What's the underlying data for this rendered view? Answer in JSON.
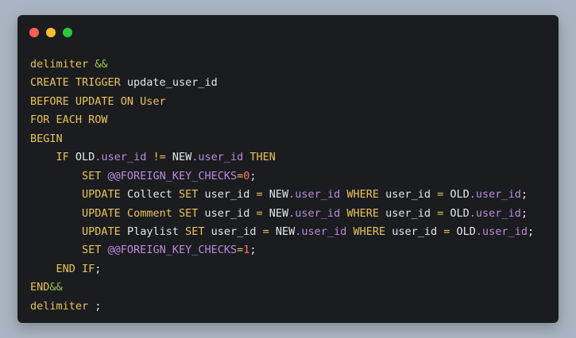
{
  "window": {
    "buttons": [
      {
        "name": "close",
        "color": "#ff5f57"
      },
      {
        "name": "minimize",
        "color": "#febc2e"
      },
      {
        "name": "maximize",
        "color": "#28c840"
      }
    ]
  },
  "colors": {
    "background": "#a9b5c2",
    "editor": "#1b1c1f",
    "keyword": "#e8c35c",
    "plain": "#e6e6e6",
    "property": "#b98bdc",
    "number": "#ff6b6b",
    "delimiter_symbol": "#96c24a"
  },
  "code_lines": [
    [
      {
        "t": "delimiter ",
        "c": "keyword"
      },
      {
        "t": "&&",
        "c": "amp"
      }
    ],
    [
      {
        "t": "CREATE TRIGGER ",
        "c": "keyword"
      },
      {
        "t": "update_user_id",
        "c": "plain"
      }
    ],
    [
      {
        "t": "BEFORE UPDATE ON ",
        "c": "keyword"
      },
      {
        "t": "User",
        "c": "keyword"
      }
    ],
    [
      {
        "t": "FOR EACH ROW",
        "c": "keyword"
      }
    ],
    [
      {
        "t": "BEGIN",
        "c": "keyword"
      }
    ],
    [
      {
        "t": "    ",
        "c": "plain"
      },
      {
        "t": "IF ",
        "c": "keyword"
      },
      {
        "t": "OLD",
        "c": "plain"
      },
      {
        "t": ".user_id",
        "c": "prop"
      },
      {
        "t": " != ",
        "c": "op"
      },
      {
        "t": "NEW",
        "c": "plain"
      },
      {
        "t": ".user_id",
        "c": "prop"
      },
      {
        "t": " THEN",
        "c": "keyword"
      }
    ],
    [
      {
        "t": "        ",
        "c": "plain"
      },
      {
        "t": "SET ",
        "c": "keyword"
      },
      {
        "t": "@@FOREIGN_KEY_CHECKS",
        "c": "var"
      },
      {
        "t": "=",
        "c": "op"
      },
      {
        "t": "0",
        "c": "num"
      },
      {
        "t": ";",
        "c": "plain"
      }
    ],
    [
      {
        "t": "        ",
        "c": "plain"
      },
      {
        "t": "UPDATE ",
        "c": "keyword"
      },
      {
        "t": "Collect ",
        "c": "plain"
      },
      {
        "t": "SET ",
        "c": "keyword"
      },
      {
        "t": "user_id ",
        "c": "plain"
      },
      {
        "t": "= ",
        "c": "op"
      },
      {
        "t": "NEW",
        "c": "plain"
      },
      {
        "t": ".user_id",
        "c": "prop"
      },
      {
        "t": " WHERE ",
        "c": "keyword"
      },
      {
        "t": "user_id ",
        "c": "plain"
      },
      {
        "t": "= ",
        "c": "op"
      },
      {
        "t": "OLD",
        "c": "plain"
      },
      {
        "t": ".user_id",
        "c": "prop"
      },
      {
        "t": ";",
        "c": "plain"
      }
    ],
    [
      {
        "t": "        ",
        "c": "plain"
      },
      {
        "t": "UPDATE ",
        "c": "keyword"
      },
      {
        "t": "Comment ",
        "c": "keyword"
      },
      {
        "t": "SET ",
        "c": "keyword"
      },
      {
        "t": "user_id ",
        "c": "plain"
      },
      {
        "t": "= ",
        "c": "op"
      },
      {
        "t": "NEW",
        "c": "plain"
      },
      {
        "t": ".user_id",
        "c": "prop"
      },
      {
        "t": " WHERE ",
        "c": "keyword"
      },
      {
        "t": "user_id ",
        "c": "plain"
      },
      {
        "t": "= ",
        "c": "op"
      },
      {
        "t": "OLD",
        "c": "plain"
      },
      {
        "t": ".user_id",
        "c": "prop"
      },
      {
        "t": ";",
        "c": "plain"
      }
    ],
    [
      {
        "t": "        ",
        "c": "plain"
      },
      {
        "t": "UPDATE ",
        "c": "keyword"
      },
      {
        "t": "Playlist ",
        "c": "plain"
      },
      {
        "t": "SET ",
        "c": "keyword"
      },
      {
        "t": "user_id ",
        "c": "plain"
      },
      {
        "t": "= ",
        "c": "op"
      },
      {
        "t": "NEW",
        "c": "plain"
      },
      {
        "t": ".user_id",
        "c": "prop"
      },
      {
        "t": " WHERE ",
        "c": "keyword"
      },
      {
        "t": "user_id ",
        "c": "plain"
      },
      {
        "t": "= ",
        "c": "op"
      },
      {
        "t": "OLD",
        "c": "plain"
      },
      {
        "t": ".user_id",
        "c": "prop"
      },
      {
        "t": ";",
        "c": "plain"
      }
    ],
    [
      {
        "t": "        ",
        "c": "plain"
      },
      {
        "t": "SET ",
        "c": "keyword"
      },
      {
        "t": "@@FOREIGN_KEY_CHECKS",
        "c": "var"
      },
      {
        "t": "=",
        "c": "op"
      },
      {
        "t": "1",
        "c": "num"
      },
      {
        "t": ";",
        "c": "plain"
      }
    ],
    [
      {
        "t": "    ",
        "c": "plain"
      },
      {
        "t": "END IF",
        "c": "keyword"
      },
      {
        "t": ";",
        "c": "plain"
      }
    ],
    [
      {
        "t": "END",
        "c": "keyword"
      },
      {
        "t": "&&",
        "c": "amp"
      }
    ],
    [
      {
        "t": "delimiter ",
        "c": "keyword"
      },
      {
        "t": ";",
        "c": "plain"
      }
    ]
  ]
}
